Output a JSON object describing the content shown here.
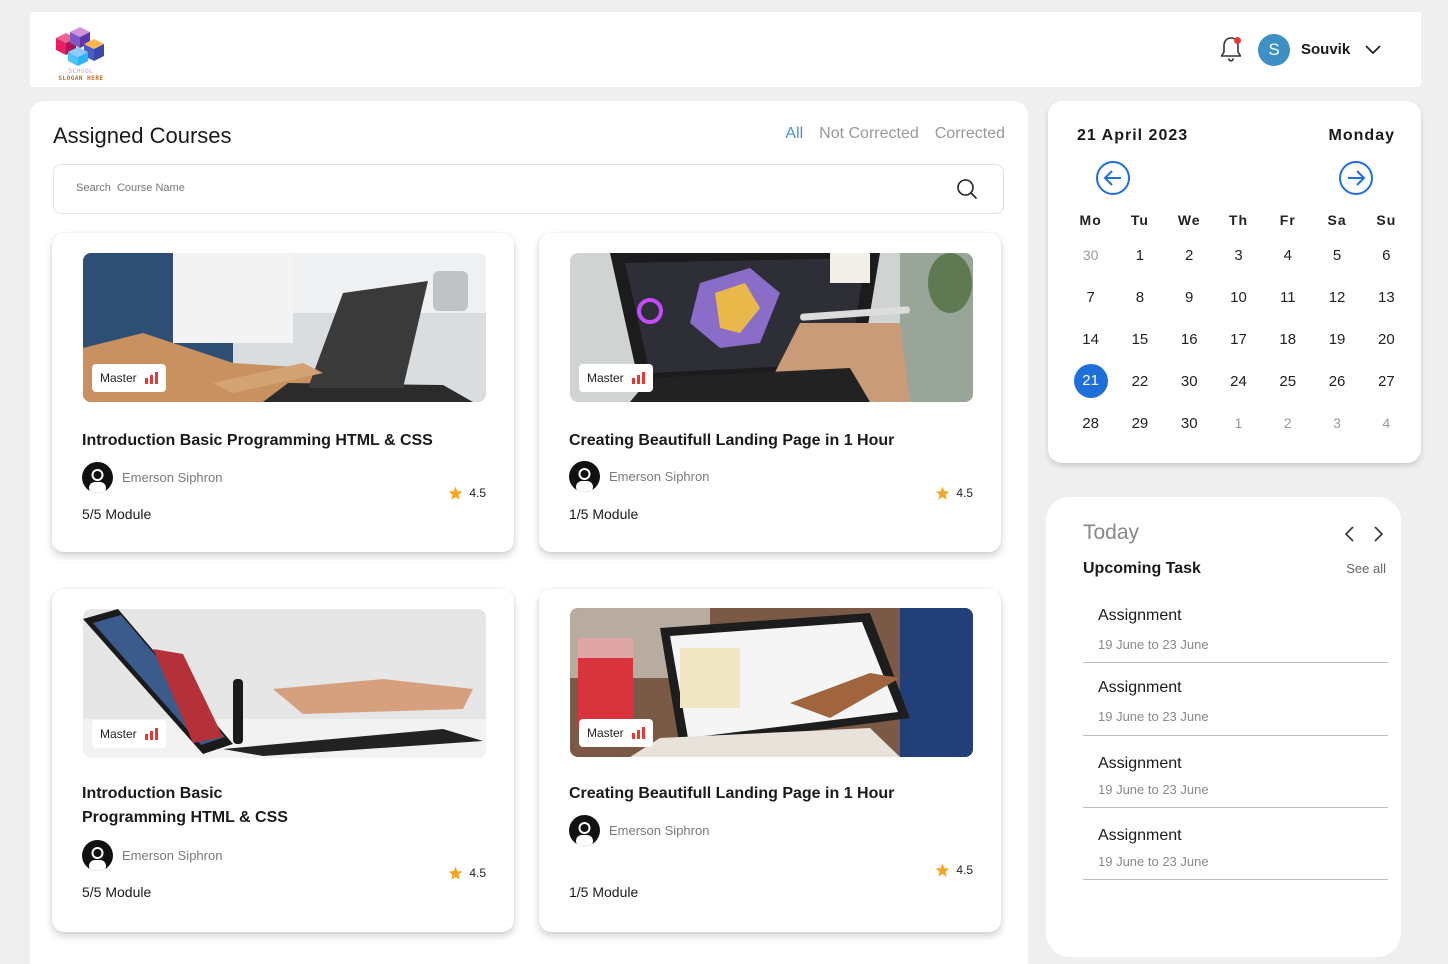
{
  "header": {
    "logo_line1": "SCHOOL",
    "logo_line2": "SLOGAN HERE",
    "user_initial": "S",
    "user_name": "Souvik"
  },
  "main": {
    "title": "Assigned Courses",
    "filters": [
      "All",
      "Not Corrected",
      "Corrected"
    ],
    "active_filter": "All",
    "search_placeholder": "Search  Course Name"
  },
  "courses": [
    {
      "badge": "Master",
      "title": "Introduction Basic Programming HTML & CSS",
      "author": "Emerson Siphron",
      "rating": "4.5",
      "module": "5/5 Module"
    },
    {
      "badge": "Master",
      "title": "Creating Beautifull Landing Page in 1 Hour",
      "author": "Emerson Siphron",
      "rating": "4.5",
      "module": "1/5 Module"
    },
    {
      "badge": "Master",
      "title": "Introduction Basic Programming HTML & CSS",
      "author": "Emerson Siphron",
      "rating": "4.5",
      "module": "5/5 Module"
    },
    {
      "badge": "Master",
      "title": "Creating Beautifull Landing Page in 1 Hour",
      "author": "Emerson Siphron",
      "rating": "4.5",
      "module": "1/5 Module"
    }
  ],
  "calendar": {
    "date": "21 April 2023",
    "weekday": "Monday",
    "weekdays": [
      "Mo",
      "Tu",
      "We",
      "Th",
      "Fr",
      "Sa",
      "Su"
    ],
    "weeks": [
      [
        "30",
        "1",
        "2",
        "3",
        "4",
        "5",
        "6"
      ],
      [
        "7",
        "8",
        "9",
        "10",
        "11",
        "12",
        "13"
      ],
      [
        "14",
        "15",
        "16",
        "17",
        "18",
        "19",
        "20"
      ],
      [
        "21",
        "22",
        "30",
        "24",
        "25",
        "26",
        "27"
      ],
      [
        "28",
        "29",
        "30",
        "1",
        "2",
        "3",
        "4"
      ]
    ],
    "selected": "21",
    "accent": "#1e6fd9"
  },
  "tasks": {
    "today_label": "Today",
    "heading": "Upcoming Task",
    "see_all": "See all",
    "items": [
      {
        "title": "Assignment",
        "range": "19 June to 23 June"
      },
      {
        "title": "Assignment",
        "range": "19 June to 23 June"
      },
      {
        "title": "Assignment",
        "range": "19 June to 23 June"
      },
      {
        "title": "Assignment",
        "range": "19 June to 23 June"
      }
    ]
  }
}
